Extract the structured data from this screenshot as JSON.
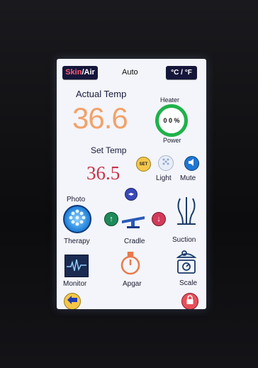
{
  "header": {
    "skin_label": "Skin",
    "air_label": "Air",
    "mode": "Auto",
    "unit_toggle": "°C / °F"
  },
  "actual_temp": {
    "label": "Actual Temp",
    "value": "36.6"
  },
  "heater": {
    "top_label": "Heater",
    "value": "0 0 %",
    "bottom_label": "Power"
  },
  "set_temp": {
    "label": "Set Temp",
    "value": "36.5",
    "set_button": "SET"
  },
  "controls": {
    "light_label": "Light",
    "mute_label": "Mute",
    "photo_label": "Photo",
    "therapy_label": "Therapy",
    "cradle_label": "Cradle",
    "suction_label": "Suction",
    "monitor_label": "Monitor",
    "apgar_label": "Apgar",
    "scale_label": "Scale"
  },
  "colors": {
    "actual_temp": "#f2a26a",
    "set_temp": "#c8324a",
    "heater_ring": "#1fb24a",
    "dark_button": "#15163a",
    "icon_blue": "#1e78d2",
    "icon_green": "#1e8a5a",
    "icon_red": "#d23a3a",
    "apgar_orange": "#e87a4a",
    "lock_red": "#e8505a"
  }
}
